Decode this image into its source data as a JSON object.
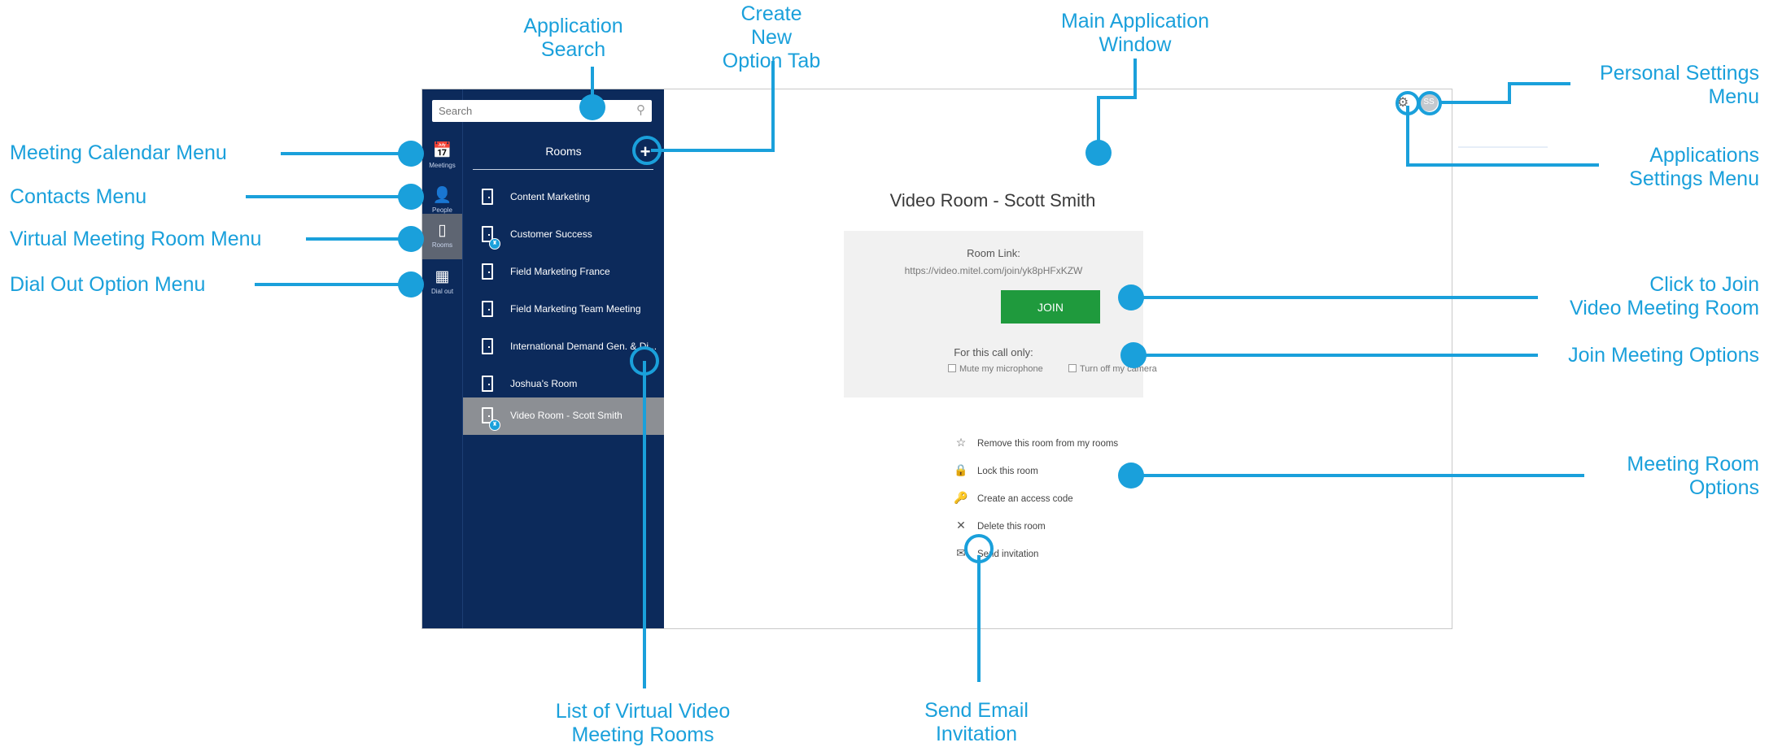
{
  "callouts": {
    "application_search": [
      "Application",
      "Search"
    ],
    "create_new_option_tab": [
      "Create",
      "New",
      "Option Tab"
    ],
    "main_application_window": [
      "Main Application",
      "Window"
    ],
    "personal_settings_menu": [
      "Personal Settings",
      "Menu"
    ],
    "applications_settings_menu": [
      "Applications",
      "Settings Menu"
    ],
    "meeting_calendar_menu": "Meeting Calendar Menu",
    "contacts_menu": "Contacts Menu",
    "virtual_meeting_room_menu": "Virtual Meeting Room Menu",
    "dial_out_option_menu": "Dial Out Option Menu",
    "click_to_join": [
      "Click to Join",
      "Video Meeting Room"
    ],
    "join_meeting_options": "Join Meeting Options",
    "meeting_room_options": [
      "Meeting Room",
      "Options"
    ],
    "list_of_virtual_rooms": [
      "List of Virtual Video",
      "Meeting Rooms"
    ],
    "send_email_invitation": [
      "Send Email",
      "Invitation"
    ]
  },
  "app": {
    "search_placeholder": "Search",
    "nav": [
      {
        "label": "Meetings",
        "icon": "calendar-icon"
      },
      {
        "label": "People",
        "icon": "contacts-icon"
      },
      {
        "label": "Rooms",
        "icon": "door-icon",
        "active": true
      },
      {
        "label": "Dial out",
        "icon": "dialpad-icon"
      }
    ],
    "rooms_title": "Rooms",
    "add_glyph": "+",
    "rooms": [
      {
        "name": "Content Marketing",
        "badge": false
      },
      {
        "name": "Customer Success",
        "badge": true
      },
      {
        "name": "Field Marketing France",
        "badge": false
      },
      {
        "name": "Field Marketing Team Meeting",
        "badge": false
      },
      {
        "name": "International Demand Gen. & Di...",
        "badge": false
      },
      {
        "name": "Joshua's Room",
        "badge": false
      },
      {
        "name": "Video Room - Scott Smith",
        "badge": true,
        "active": true
      }
    ],
    "main": {
      "title": "Video Room - Scott Smith",
      "room_link_label": "Room Link:",
      "room_link_url": "https://video.mitel.com/join/yk8pHFxKZW",
      "join_label": "JOIN",
      "call_only_label": "For this call only:",
      "mute_label": "Mute my microphone",
      "camera_label": "Turn off my camera",
      "options": [
        {
          "label": "Remove this room from my rooms",
          "icon": "star-icon"
        },
        {
          "label": "Lock this room",
          "icon": "lock-icon"
        },
        {
          "label": "Create an access code",
          "icon": "key-icon"
        },
        {
          "label": "Delete this room",
          "icon": "close-icon"
        },
        {
          "label": "Send invitation",
          "icon": "envelope-icon"
        }
      ]
    },
    "avatar_initials": "SS"
  },
  "colors": {
    "callout": "#1aa0db",
    "sidebar": "#0c2a5b",
    "join_button": "#1f9a3d",
    "active_row": "#8c8f94"
  }
}
